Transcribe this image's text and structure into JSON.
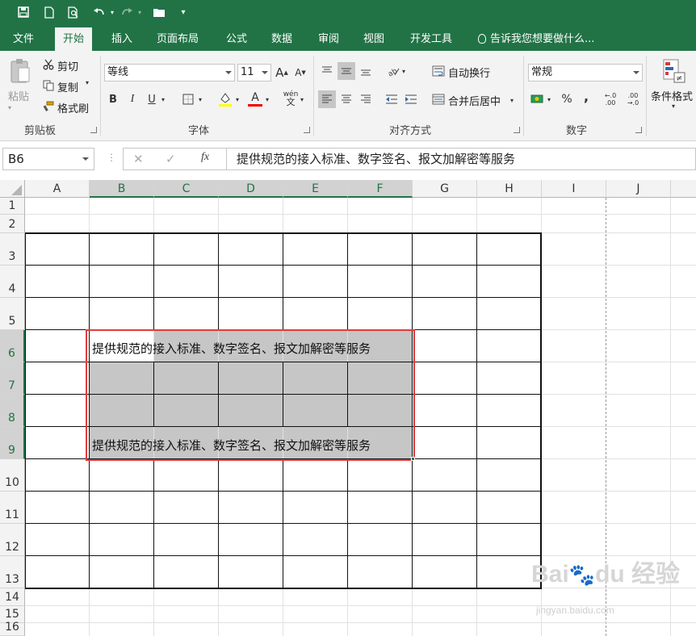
{
  "quick_access": {
    "items": [
      "save-icon",
      "new-icon",
      "print-preview-icon",
      "undo-icon",
      "redo-icon",
      "open-icon",
      "customize-icon"
    ]
  },
  "tabs": [
    {
      "label": "文件"
    },
    {
      "label": "开始"
    },
    {
      "label": "插入"
    },
    {
      "label": "页面布局"
    },
    {
      "label": "公式"
    },
    {
      "label": "数据"
    },
    {
      "label": "审阅"
    },
    {
      "label": "视图"
    },
    {
      "label": "开发工具"
    }
  ],
  "tell_me": "告诉我您想要做什么...",
  "ribbon": {
    "clipboard": {
      "paste": "粘贴",
      "cut": "剪切",
      "copy": "复制",
      "format_painter": "格式刷",
      "label": "剪贴板"
    },
    "font": {
      "font_name": "等线",
      "font_size": "11",
      "label": "字体",
      "bold": "B",
      "italic": "I",
      "underline": "U",
      "grow": "A",
      "shrink": "A",
      "font_color_glyph": "A",
      "phonetic": "wén"
    },
    "alignment": {
      "wrap_text": "自动换行",
      "merge_center": "合并后居中",
      "label": "对齐方式"
    },
    "number": {
      "format": "常规",
      "percent": "%",
      "comma": ",",
      "label": "数字"
    },
    "styles": {
      "conditional_format": "条件格式"
    }
  },
  "formula_bar": {
    "name_box": "B6",
    "fx": "fx",
    "cancel": "✕",
    "enter": "✓",
    "value": "提供规范的接入标准、数字签名、报文加解密等服务"
  },
  "sheet": {
    "columns": [
      "A",
      "B",
      "C",
      "D",
      "E",
      "F",
      "G",
      "H",
      "I",
      "J"
    ],
    "rows": [
      "1",
      "2",
      "3",
      "4",
      "5",
      "6",
      "7",
      "8",
      "9",
      "10",
      "11",
      "12",
      "13",
      "14",
      "15",
      "16"
    ],
    "cell_b6": "提供规范的接入标准、数字签名、报文加解密等服务",
    "cell_b9": "提供规范的接入标准、数字签名、报文加解密等服务",
    "selection_color": "#e23c3c",
    "accent": "#217346"
  }
}
